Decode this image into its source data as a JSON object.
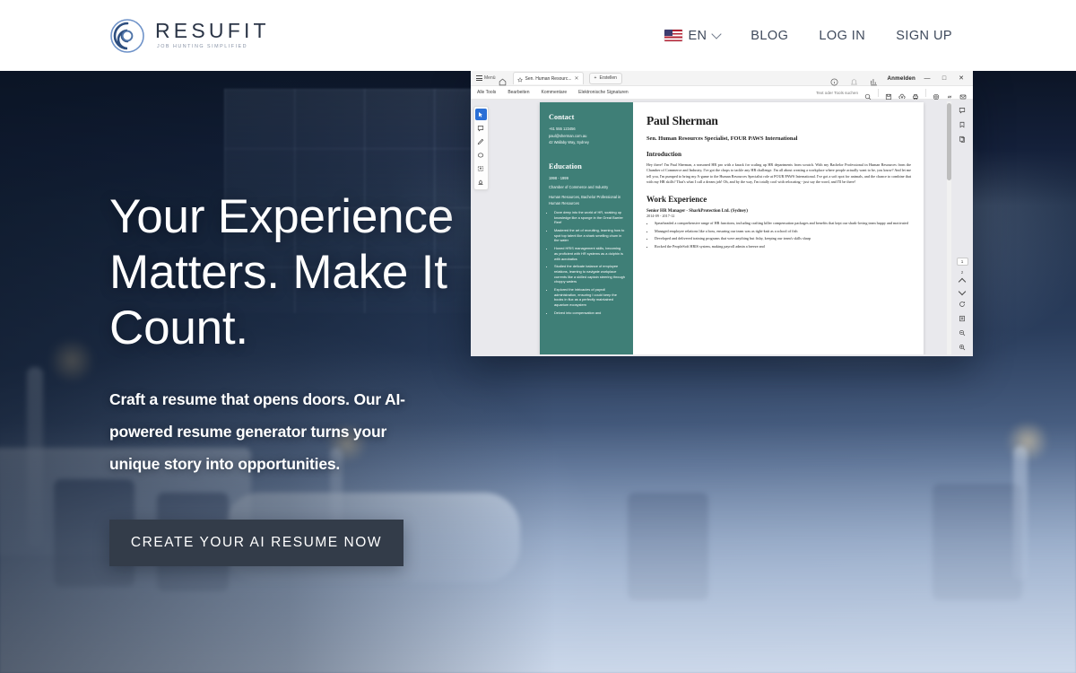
{
  "header": {
    "logo": {
      "word": "RESUFIT",
      "tagline": "JOB HUNTING SIMPLIFIED",
      "icon": "resufit-circle-logo-icon"
    },
    "nav": {
      "lang": {
        "code": "EN",
        "flag": "us-flag-icon",
        "chevron": "chevron-down-icon"
      },
      "links": [
        {
          "label": "BLOG"
        },
        {
          "label": "LOG IN"
        },
        {
          "label": "SIGN UP"
        }
      ]
    }
  },
  "hero": {
    "title": "Your Experience Matters. Make It Count.",
    "subtitle": "Craft a resume that opens doors. Our AI-powered resume generator turns your unique story into opportunities.",
    "cta_label": "CREATE YOUR AI RESUME NOW",
    "cta_bg": "#333c49"
  },
  "app_window": {
    "titlebar": {
      "menu_label": "Menü",
      "menu_icon": "hamburger-icon",
      "home_icon": "home-icon",
      "tab": {
        "star_icon": "star-icon",
        "title": "Sen. Human Resourc...",
        "close_icon": "close-icon"
      },
      "create_button": {
        "plus": "+",
        "label": "Erstellen"
      },
      "info_icon": "info-icon",
      "bell_icon": "notification-icon",
      "share_icon": "share-icon",
      "signin_label": "Anmelden",
      "minimize": "—",
      "maximize": "□",
      "close": "✕"
    },
    "toolbar": {
      "items": [
        "Alle Tools",
        "Bearbeiten",
        "Kommentare",
        "Elektronische Signaturen"
      ],
      "search_placeholder": "Text oder Tools suchen",
      "search_icon": "search-icon",
      "right_icons": [
        "save-icon",
        "cloud-upload-icon",
        "print-icon",
        "settings-icon",
        "link-icon",
        "mail-icon"
      ]
    },
    "left_rail": [
      {
        "icon": "select-cursor-icon",
        "active": true
      },
      {
        "icon": "comment-icon",
        "active": false
      },
      {
        "icon": "pen-icon",
        "active": false
      },
      {
        "icon": "shape-icon",
        "active": false
      },
      {
        "icon": "textbox-icon",
        "active": false
      },
      {
        "icon": "stamp-icon",
        "active": false
      }
    ],
    "right_rail": {
      "top_icons": [
        "comment-panel-icon",
        "bookmark-icon",
        "pages-icon"
      ],
      "page_current": "1",
      "page_total": "2",
      "prev_icon": "chevron-up-icon",
      "next_icon": "chevron-down-icon",
      "rotate_icon": "rotate-icon",
      "fit_icon": "fit-page-icon",
      "zoom_out_icon": "zoom-out-icon",
      "zoom_in_icon": "zoom-in-icon"
    },
    "document": {
      "sidebar": {
        "accent_color": "#3f7f77",
        "contact": {
          "heading": "Contact",
          "phone": "+61 555 123456",
          "email": "paul@sherman.com.au",
          "address": "42 Wallaby Way, Sydney"
        },
        "education": {
          "heading": "Education",
          "dates": "1998 - 1999",
          "institution": "Chamber of Commerce and Industry",
          "degree": "Human Resources, Bachelor Professional in Human Resources",
          "bullets": [
            "Dove deep into the world of HR, soaking up knowledge like a sponge in the Great Barrier Reef",
            "Mastered the art of recruiting, learning how to spot top talent like a shark smelling chum in the water",
            "Honed HRIS management skills, becoming as proficient with HR systems as a dolphin is with acrobatics",
            "Studied the delicate balance of employee relations, learning to navigate workplace currents like a skilled captain steering through choppy waters",
            "Explored the intricacies of payroll administration, ensuring I could keep the books in flux as a perfectly maintained aquarium ecosystem",
            "Delved into compensation and"
          ]
        }
      },
      "main": {
        "name": "Paul Sherman",
        "role": "Sen. Human Resources Specialist, FOUR PAWS International",
        "intro_heading": "Introduction",
        "intro_text": "Hey there! I'm Paul Sherman, a seasoned HR pro with a knack for scaling up HR departments from scratch. With my Bachelor Professional in Human Resources from the Chamber of Commerce and Industry, I've got the chops to tackle any HR challenge. I'm all about creating a workplace where people actually want to be, you know? And let me tell you, I'm pumped to bring my A-game to the Human Resources Specialist role at FOUR PAWS International. I've got a soft spot for animals, and the chance to combine that with my HR skills? That's what I call a dream job! Oh, and by the way, I'm totally cool with relocating - just say the word, and I'll be there!",
        "experience_heading": "Work Experience",
        "jobs": [
          {
            "title": "Senior HR Manager - SharkProtection Ltd. (Sydney)",
            "dates": "2014-09 - 2017-12",
            "bullets": [
              "Spearheaded a comprehensive range of HR functions, including crafting killer compensation packages and benefits that kept our shark-loving team happy and motivated",
              "Managed employee relations like a boss, ensuring our team was as tight-knit as a school of fish",
              "Developed and delivered training programs that were anything but fishy, keeping our team's skills sharp",
              "Rocked the PeopleSoft HRIS system, making payroll admin a breeze and"
            ]
          }
        ]
      }
    }
  }
}
